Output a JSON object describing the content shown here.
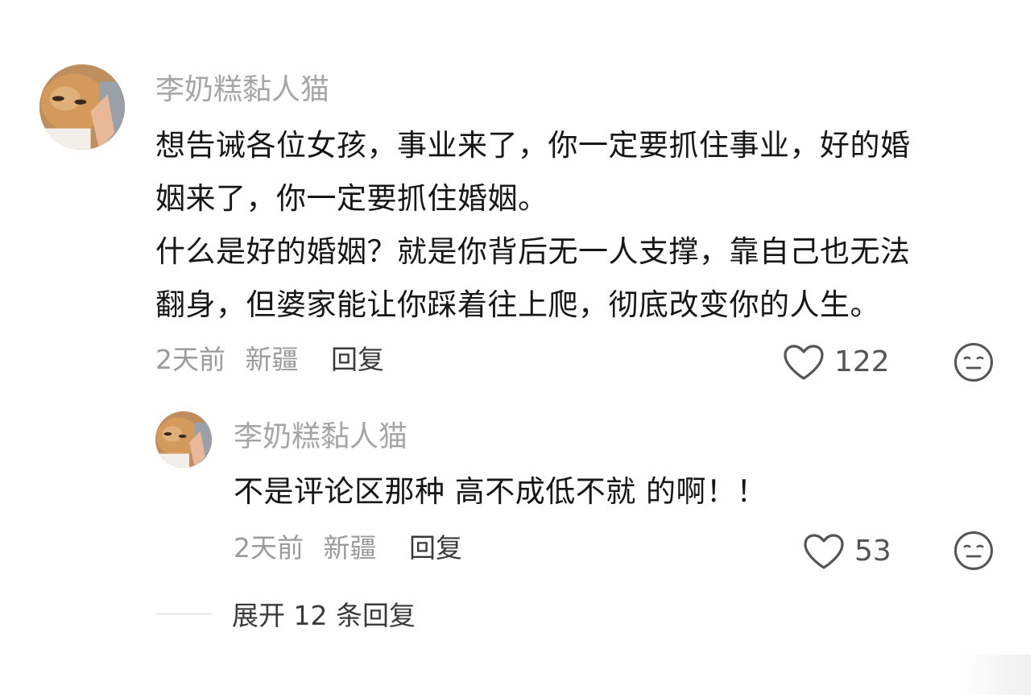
{
  "comment": {
    "username": "李奶糕黏人猫",
    "content": "想告诫各位女孩，事业来了，你一定要抓住事业，好的婚\n姻来了，你一定要抓住婚姻。\n什么是好的婚姻？就是你背后无一人支撑，靠自己也无法\n翻身，但婆家能让你踩着往上爬，彻底改变你的人生。",
    "time": "2天前",
    "location": "新疆",
    "reply_label": "回复",
    "likes": "122"
  },
  "reply": {
    "username": "李奶糕黏人猫",
    "content": "不是评论区那种 高不成低不就 的啊！！",
    "time": "2天前",
    "location": "新疆",
    "reply_label": "回复",
    "likes": "53"
  },
  "expand": {
    "label": "展开 12 条回复"
  },
  "icons": {
    "like": "heart-outline-icon",
    "reaction": "meh-face-icon"
  }
}
